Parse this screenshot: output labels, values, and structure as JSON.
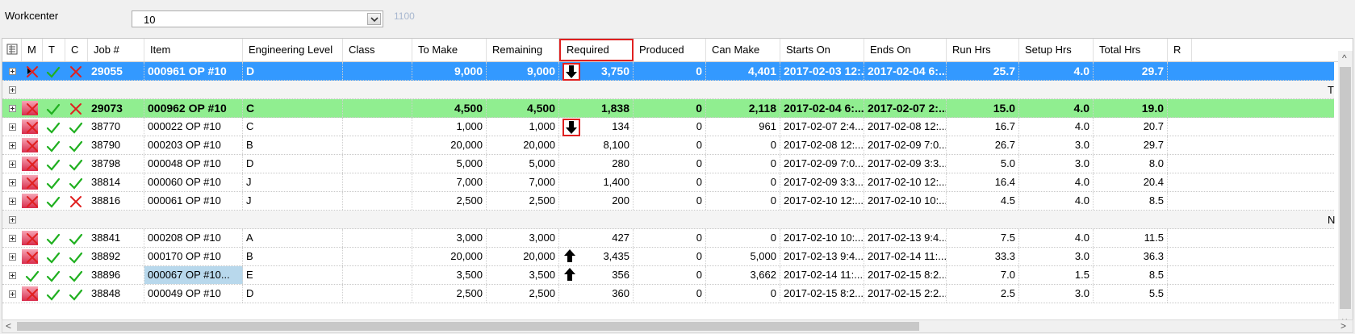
{
  "toolbar": {
    "workcenter_label": "Workcenter",
    "workcenter_value": "10",
    "workcenter_hint": "1100"
  },
  "columns": [
    {
      "key": "m",
      "label": "M"
    },
    {
      "key": "t",
      "label": "T"
    },
    {
      "key": "c",
      "label": "C"
    },
    {
      "key": "job",
      "label": "Job #"
    },
    {
      "key": "item",
      "label": "Item"
    },
    {
      "key": "eng",
      "label": "Engineering Level"
    },
    {
      "key": "class",
      "label": "Class"
    },
    {
      "key": "tomake",
      "label": "To Make"
    },
    {
      "key": "remaining",
      "label": "Remaining"
    },
    {
      "key": "required",
      "label": "Required"
    },
    {
      "key": "produced",
      "label": "Produced"
    },
    {
      "key": "canmake",
      "label": "Can Make"
    },
    {
      "key": "starts",
      "label": "Starts On"
    },
    {
      "key": "ends",
      "label": "Ends On"
    },
    {
      "key": "run",
      "label": "Run Hrs"
    },
    {
      "key": "setup",
      "label": "Setup Hrs"
    },
    {
      "key": "total",
      "label": "Total Hrs"
    },
    {
      "key": "r",
      "label": "R"
    }
  ],
  "rows": [
    {
      "type": "selected",
      "flag": false,
      "m": "x",
      "t": "check",
      "c": "x",
      "job": "29055",
      "item": "000961 OP #10",
      "eng": "D",
      "class": "",
      "tomake": "9,000",
      "remaining": "9,000",
      "required": "3,750",
      "produced": "0",
      "canmake": "4,401",
      "starts": "2017-02-03 12:...",
      "ends": "2017-02-04 6:...",
      "run": "25.7",
      "setup": "4.0",
      "total": "29.7",
      "arrow": "down-boxed"
    },
    {
      "type": "sep",
      "edge": "T"
    },
    {
      "type": "group",
      "flag": true,
      "m": "x",
      "t": "check",
      "c": "x",
      "job": "29073",
      "item": "000962 OP #10",
      "eng": "C",
      "class": "",
      "tomake": "4,500",
      "remaining": "4,500",
      "required": "1,838",
      "produced": "0",
      "canmake": "2,118",
      "starts": "2017-02-04 6:...",
      "ends": "2017-02-07 2:...",
      "run": "15.0",
      "setup": "4.0",
      "total": "19.0"
    },
    {
      "type": "normal",
      "flag": true,
      "m": "x",
      "t": "check",
      "c": "check",
      "job": "38770",
      "item": "000022 OP #10",
      "eng": "C",
      "class": "",
      "tomake": "1,000",
      "remaining": "1,000",
      "required": "134",
      "produced": "0",
      "canmake": "961",
      "starts": "2017-02-07 2:4...",
      "ends": "2017-02-08 12:...",
      "run": "16.7",
      "setup": "4.0",
      "total": "20.7",
      "arrow": "down-boxed"
    },
    {
      "type": "normal",
      "flag": true,
      "m": "x",
      "t": "check",
      "c": "check",
      "job": "38790",
      "item": "000203 OP #10",
      "eng": "B",
      "class": "",
      "tomake": "20,000",
      "remaining": "20,000",
      "required": "8,100",
      "produced": "0",
      "canmake": "0",
      "starts": "2017-02-08 12:...",
      "ends": "2017-02-09 7:0...",
      "run": "26.7",
      "setup": "3.0",
      "total": "29.7"
    },
    {
      "type": "normal",
      "flag": true,
      "m": "x",
      "t": "check",
      "c": "check",
      "job": "38798",
      "item": "000048 OP #10",
      "eng": "D",
      "class": "",
      "tomake": "5,000",
      "remaining": "5,000",
      "required": "280",
      "produced": "0",
      "canmake": "0",
      "starts": "2017-02-09 7:0...",
      "ends": "2017-02-09 3:3...",
      "run": "5.0",
      "setup": "3.0",
      "total": "8.0"
    },
    {
      "type": "normal",
      "flag": true,
      "m": "x",
      "t": "check",
      "c": "check",
      "job": "38814",
      "item": "000060 OP #10",
      "eng": "J",
      "class": "",
      "tomake": "7,000",
      "remaining": "7,000",
      "required": "1,400",
      "produced": "0",
      "canmake": "0",
      "starts": "2017-02-09 3:3...",
      "ends": "2017-02-10 12:...",
      "run": "16.4",
      "setup": "4.0",
      "total": "20.4"
    },
    {
      "type": "normal",
      "flag": true,
      "m": "x",
      "t": "check",
      "c": "x",
      "job": "38816",
      "item": "000061 OP #10",
      "eng": "J",
      "class": "",
      "tomake": "2,500",
      "remaining": "2,500",
      "required": "200",
      "produced": "0",
      "canmake": "0",
      "starts": "2017-02-10 12:...",
      "ends": "2017-02-10 10:...",
      "run": "4.5",
      "setup": "4.0",
      "total": "8.5"
    },
    {
      "type": "sep",
      "edge": "N"
    },
    {
      "type": "normal",
      "flag": true,
      "m": "x",
      "t": "check",
      "c": "check",
      "job": "38841",
      "item": "000208 OP #10",
      "eng": "A",
      "class": "",
      "tomake": "3,000",
      "remaining": "3,000",
      "required": "427",
      "produced": "0",
      "canmake": "0",
      "starts": "2017-02-10 10:...",
      "ends": "2017-02-13 9:4...",
      "run": "7.5",
      "setup": "4.0",
      "total": "11.5"
    },
    {
      "type": "normal",
      "flag": true,
      "m": "x",
      "t": "check",
      "c": "check",
      "job": "38892",
      "item": "000170 OP #10",
      "eng": "B",
      "class": "",
      "tomake": "20,000",
      "remaining": "20,000",
      "required": "3,435",
      "produced": "0",
      "canmake": "5,000",
      "starts": "2017-02-13 9:4...",
      "ends": "2017-02-14 11:...",
      "run": "33.3",
      "setup": "3.0",
      "total": "36.3",
      "arrow": "up"
    },
    {
      "type": "normal",
      "flag": false,
      "m": "check",
      "t": "check",
      "c": "check",
      "job": "38896",
      "item": "000067 OP #10...",
      "itemHl": true,
      "eng": "E",
      "class": "",
      "tomake": "3,500",
      "remaining": "3,500",
      "required": "356",
      "produced": "0",
      "canmake": "3,662",
      "starts": "2017-02-14 11:...",
      "ends": "2017-02-15 8:2...",
      "run": "7.0",
      "setup": "1.5",
      "total": "8.5",
      "arrow": "up"
    },
    {
      "type": "normal",
      "flag": true,
      "m": "x",
      "t": "check",
      "c": "check",
      "job": "38848",
      "item": "000049 OP #10",
      "eng": "D",
      "class": "",
      "tomake": "2,500",
      "remaining": "2,500",
      "required": "360",
      "produced": "0",
      "canmake": "0",
      "starts": "2017-02-15 8:2...",
      "ends": "2017-02-15 2:2...",
      "run": "2.5",
      "setup": "3.0",
      "total": "5.5"
    }
  ],
  "colors": {
    "selected": "#3399ff",
    "group": "#90ee90",
    "x": "#e02020",
    "check": "#20b020",
    "highlight": "#e02020"
  }
}
